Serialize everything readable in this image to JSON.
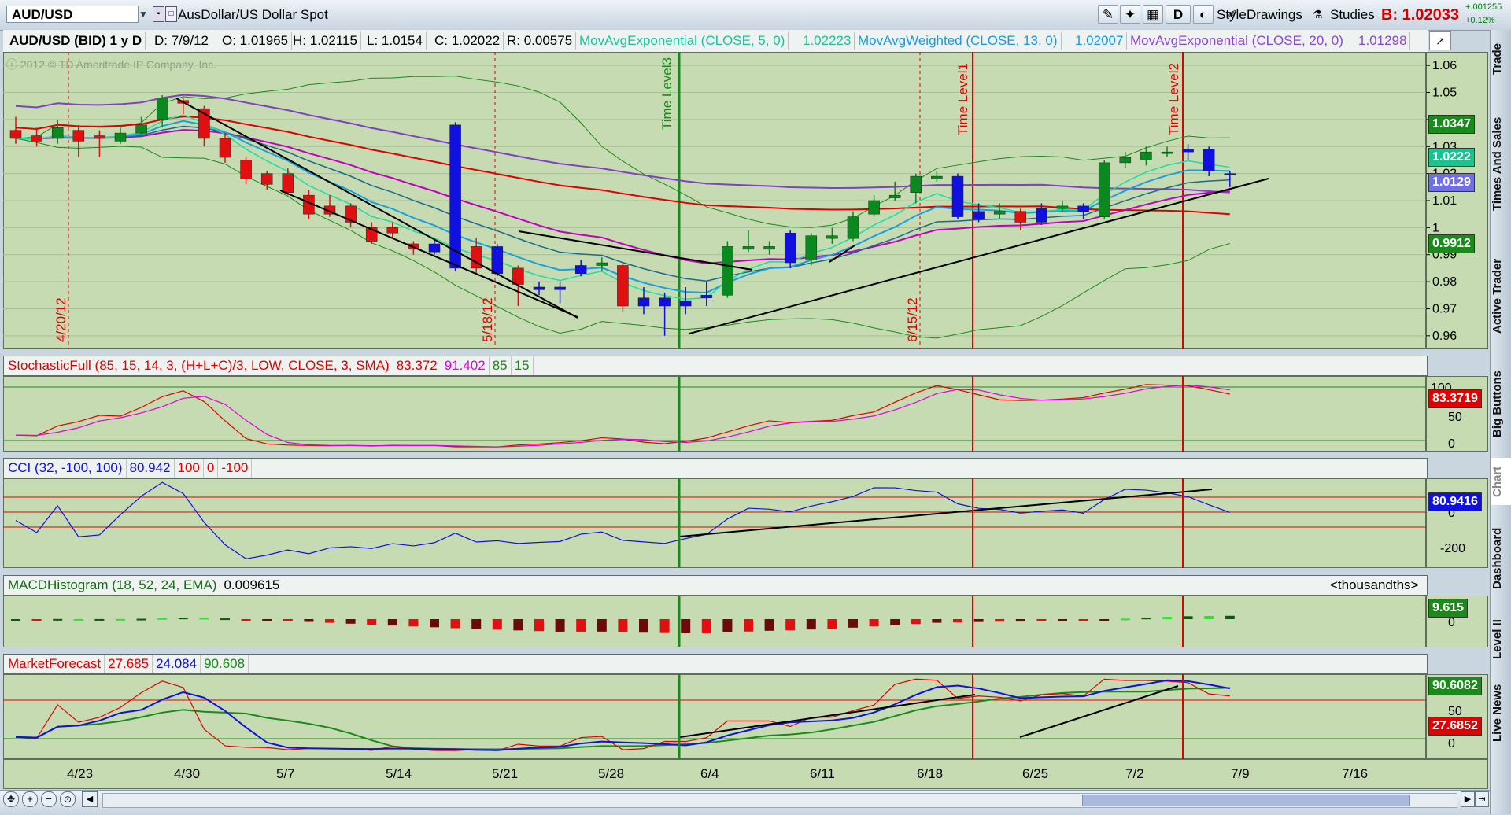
{
  "toolbar": {
    "symbol": "AUD/USD",
    "description": "AusDollar/US Dollar Spot",
    "d_label": "D",
    "style_label": "Style",
    "drawings_label": "Drawings",
    "studies_label": "Studies",
    "bid": "B: 1.02033",
    "change_points": "+.001255",
    "change_percent": "+0.12%"
  },
  "header": {
    "symbol_period": "AUD/USD (BID) 1 y D",
    "date": "D: 7/9/12",
    "open": "O: 1.01965",
    "high": "H: 1.02115",
    "low": "L: 1.0154",
    "close": "C: 1.02022",
    "range": "R: 0.00575",
    "ema5": "MovAvgExponential (CLOSE, 5, 0)",
    "ema5_val": "1.02223",
    "wma13": "MovAvgWeighted (CLOSE, 13, 0)",
    "wma13_val": "1.02007",
    "ema20": "MovAvgExponential (CLOSE, 20, 0)",
    "ema20_val": "1.01298"
  },
  "watermark": "2012 © TD Ameritrade IP Company, Inc.",
  "price_axis": {
    "ticks": [
      "1.06",
      "1.05",
      "1.04",
      "1.03",
      "1.02",
      "1.01",
      "1",
      "0.99",
      "0.98",
      "0.97",
      "0.96"
    ],
    "tag_ema5": "1.0222",
    "tag_ema20": "1.0129",
    "tag_upper": "1.0347",
    "tag_lower": "0.9912"
  },
  "annotations": {
    "date1": "4/20/12",
    "date2": "5/18/12",
    "date3": "6/15/12",
    "time3": "Time Level3",
    "time1": "Time Level1",
    "time2": "Time Level2"
  },
  "stochastic": {
    "title": "StochasticFull (85, 15, 14, 3, (H+L+C)/3, LOW, CLOSE, 3, SMA)",
    "v1": "83.372",
    "v2": "91.402",
    "v3": "85",
    "v4": "15",
    "tag": "83.3719",
    "ticks": [
      "100",
      "50",
      "0"
    ]
  },
  "cci": {
    "title": "CCI (32, -100, 100)",
    "v1": "80.942",
    "v2": "100",
    "v3": "0",
    "v4": "-100",
    "tag": "80.9416",
    "ticks": [
      "0",
      "-200"
    ]
  },
  "macd": {
    "title": "MACDHistogram (18, 52, 24, EMA)",
    "v1": "0.009615",
    "units": "<thousandths>",
    "tag": "9.615",
    "ticks": [
      "0"
    ]
  },
  "mf": {
    "title": "MarketForecast",
    "v1": "27.685",
    "v2": "24.084",
    "v3": "90.608",
    "tag_green": "90.6082",
    "tag_red": "27.6852",
    "ticks": [
      "50",
      "0"
    ]
  },
  "x_axis": [
    "4/23",
    "4/30",
    "5/7",
    "5/14",
    "5/21",
    "5/28",
    "6/4",
    "6/11",
    "6/18",
    "6/25",
    "7/2",
    "7/9",
    "7/16"
  ],
  "side_tabs": [
    "Trade",
    "Times And Sales",
    "Active Trader",
    "Big Buttons",
    "Chart",
    "Dashboard",
    "Level II",
    "Live News"
  ],
  "colors": {
    "plot_bg": "#c6dbb2",
    "up_candle": "#0a8a1e",
    "down_candle": "#e01010",
    "blue_candle": "#1010e0",
    "ema20": "#c000c0",
    "sma_red": "#e00000",
    "time_line": "#e00000",
    "time_level3": "#1a8a1a"
  },
  "chart_data": {
    "type": "candlestick",
    "ylim": [
      0.955,
      1.065
    ],
    "candles": [
      {
        "o": 1.036,
        "c": 1.033,
        "h": 1.041,
        "l": 1.031,
        "col": "red"
      },
      {
        "o": 1.034,
        "c": 1.032,
        "h": 1.037,
        "l": 1.03,
        "col": "red"
      },
      {
        "o": 1.033,
        "c": 1.037,
        "h": 1.04,
        "l": 1.031,
        "col": "green"
      },
      {
        "o": 1.036,
        "c": 1.032,
        "h": 1.038,
        "l": 1.026,
        "col": "red"
      },
      {
        "o": 1.034,
        "c": 1.033,
        "h": 1.036,
        "l": 1.026,
        "col": "red"
      },
      {
        "o": 1.032,
        "c": 1.035,
        "h": 1.037,
        "l": 1.031,
        "col": "green"
      },
      {
        "o": 1.035,
        "c": 1.038,
        "h": 1.041,
        "l": 1.034,
        "col": "green"
      },
      {
        "o": 1.04,
        "c": 1.048,
        "h": 1.049,
        "l": 1.037,
        "col": "green"
      },
      {
        "o": 1.047,
        "c": 1.046,
        "h": 1.048,
        "l": 1.042,
        "col": "red"
      },
      {
        "o": 1.044,
        "c": 1.033,
        "h": 1.045,
        "l": 1.03,
        "col": "red"
      },
      {
        "o": 1.033,
        "c": 1.026,
        "h": 1.035,
        "l": 1.024,
        "col": "red"
      },
      {
        "o": 1.025,
        "c": 1.018,
        "h": 1.026,
        "l": 1.016,
        "col": "red"
      },
      {
        "o": 1.02,
        "c": 1.016,
        "h": 1.021,
        "l": 1.014,
        "col": "red"
      },
      {
        "o": 1.02,
        "c": 1.013,
        "h": 1.022,
        "l": 1.012,
        "col": "red"
      },
      {
        "o": 1.012,
        "c": 1.005,
        "h": 1.014,
        "l": 1.003,
        "col": "red"
      },
      {
        "o": 1.008,
        "c": 1.005,
        "h": 1.012,
        "l": 1.004,
        "col": "red"
      },
      {
        "o": 1.008,
        "c": 1.002,
        "h": 1.009,
        "l": 1.0,
        "col": "red"
      },
      {
        "o": 1.0,
        "c": 0.995,
        "h": 1.002,
        "l": 0.994,
        "col": "red"
      },
      {
        "o": 1.0,
        "c": 0.998,
        "h": 1.002,
        "l": 0.996,
        "col": "red"
      },
      {
        "o": 0.994,
        "c": 0.992,
        "h": 0.995,
        "l": 0.99,
        "col": "red"
      },
      {
        "o": 0.994,
        "c": 0.991,
        "h": 0.996,
        "l": 0.99,
        "col": "blue"
      },
      {
        "o": 1.038,
        "c": 0.985,
        "h": 1.039,
        "l": 0.984,
        "col": "blue"
      },
      {
        "o": 0.993,
        "c": 0.985,
        "h": 0.996,
        "l": 0.983,
        "col": "red"
      },
      {
        "o": 0.993,
        "c": 0.983,
        "h": 0.994,
        "l": 0.982,
        "col": "blue"
      },
      {
        "o": 0.985,
        "c": 0.979,
        "h": 0.986,
        "l": 0.971,
        "col": "red"
      },
      {
        "o": 0.978,
        "c": 0.977,
        "h": 0.98,
        "l": 0.975,
        "col": "blue"
      },
      {
        "o": 0.978,
        "c": 0.977,
        "h": 0.98,
        "l": 0.972,
        "col": "blue"
      },
      {
        "o": 0.983,
        "c": 0.986,
        "h": 0.988,
        "l": 0.982,
        "col": "blue"
      },
      {
        "o": 0.986,
        "c": 0.987,
        "h": 0.989,
        "l": 0.984,
        "col": "green"
      },
      {
        "o": 0.986,
        "c": 0.971,
        "h": 0.987,
        "l": 0.969,
        "col": "red"
      },
      {
        "o": 0.974,
        "c": 0.971,
        "h": 0.978,
        "l": 0.968,
        "col": "blue"
      },
      {
        "o": 0.974,
        "c": 0.971,
        "h": 0.976,
        "l": 0.96,
        "col": "blue"
      },
      {
        "o": 0.973,
        "c": 0.971,
        "h": 0.978,
        "l": 0.968,
        "col": "blue"
      },
      {
        "o": 0.974,
        "c": 0.975,
        "h": 0.98,
        "l": 0.971,
        "col": "blue"
      },
      {
        "o": 0.975,
        "c": 0.993,
        "h": 0.995,
        "l": 0.974,
        "col": "green"
      },
      {
        "o": 0.992,
        "c": 0.993,
        "h": 0.999,
        "l": 0.991,
        "col": "green"
      },
      {
        "o": 0.992,
        "c": 0.993,
        "h": 0.995,
        "l": 0.99,
        "col": "green"
      },
      {
        "o": 0.998,
        "c": 0.987,
        "h": 0.999,
        "l": 0.985,
        "col": "blue"
      },
      {
        "o": 0.988,
        "c": 0.997,
        "h": 0.998,
        "l": 0.986,
        "col": "green"
      },
      {
        "o": 0.996,
        "c": 0.997,
        "h": 1.0,
        "l": 0.994,
        "col": "green"
      },
      {
        "o": 0.996,
        "c": 1.004,
        "h": 1.006,
        "l": 0.995,
        "col": "green"
      },
      {
        "o": 1.005,
        "c": 1.01,
        "h": 1.012,
        "l": 1.004,
        "col": "green"
      },
      {
        "o": 1.011,
        "c": 1.012,
        "h": 1.017,
        "l": 1.01,
        "col": "green"
      },
      {
        "o": 1.013,
        "c": 1.019,
        "h": 1.02,
        "l": 1.009,
        "col": "green"
      },
      {
        "o": 1.018,
        "c": 1.019,
        "h": 1.021,
        "l": 1.017,
        "col": "green"
      },
      {
        "o": 1.019,
        "c": 1.004,
        "h": 1.02,
        "l": 1.003,
        "col": "blue"
      },
      {
        "o": 1.003,
        "c": 1.006,
        "h": 1.009,
        "l": 1.002,
        "col": "blue"
      },
      {
        "o": 1.006,
        "c": 1.005,
        "h": 1.009,
        "l": 1.003,
        "col": "green"
      },
      {
        "o": 1.006,
        "c": 1.002,
        "h": 1.007,
        "l": 0.999,
        "col": "red"
      },
      {
        "o": 1.002,
        "c": 1.007,
        "h": 1.009,
        "l": 1.001,
        "col": "blue"
      },
      {
        "o": 1.007,
        "c": 1.008,
        "h": 1.01,
        "l": 1.006,
        "col": "green"
      },
      {
        "o": 1.008,
        "c": 1.006,
        "h": 1.009,
        "l": 1.003,
        "col": "blue"
      },
      {
        "o": 1.004,
        "c": 1.024,
        "h": 1.025,
        "l": 1.003,
        "col": "green"
      },
      {
        "o": 1.024,
        "c": 1.026,
        "h": 1.028,
        "l": 1.022,
        "col": "green"
      },
      {
        "o": 1.025,
        "c": 1.028,
        "h": 1.03,
        "l": 1.023,
        "col": "green"
      },
      {
        "o": 1.028,
        "c": 1.028,
        "h": 1.03,
        "l": 1.026,
        "col": "green"
      },
      {
        "o": 1.029,
        "c": 1.028,
        "h": 1.031,
        "l": 1.025,
        "col": "blue"
      },
      {
        "o": 1.029,
        "c": 1.021,
        "h": 1.03,
        "l": 1.019,
        "col": "blue"
      },
      {
        "o": 1.02,
        "c": 1.02,
        "h": 1.021,
        "l": 1.015,
        "col": "blue"
      }
    ]
  }
}
